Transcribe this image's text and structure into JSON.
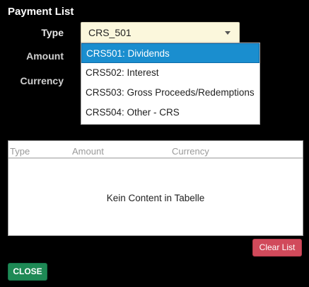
{
  "window": {
    "title": "Payment List"
  },
  "form": {
    "type_label": "Type",
    "amount_label": "Amount",
    "currency_label": "Currency",
    "type_value": "CRS_501"
  },
  "dropdown": {
    "options": [
      "CRS501: Dividends",
      "CRS502: Interest",
      "CRS503: Gross Proceeds/Redemptions",
      "CRS504: Other - CRS"
    ],
    "selected_index": 0
  },
  "table": {
    "columns": [
      "Type",
      "Amount",
      "Currency"
    ],
    "empty_text": "Kein Content in Tabelle"
  },
  "buttons": {
    "clear_label": "Clear List",
    "close_label": "CLOSE"
  },
  "colors": {
    "background": "#000000",
    "select_bg": "#fbf7dc",
    "selected_option": "#1a8ecf",
    "clear_button": "#d14a5b",
    "close_button": "#1e8a55"
  }
}
